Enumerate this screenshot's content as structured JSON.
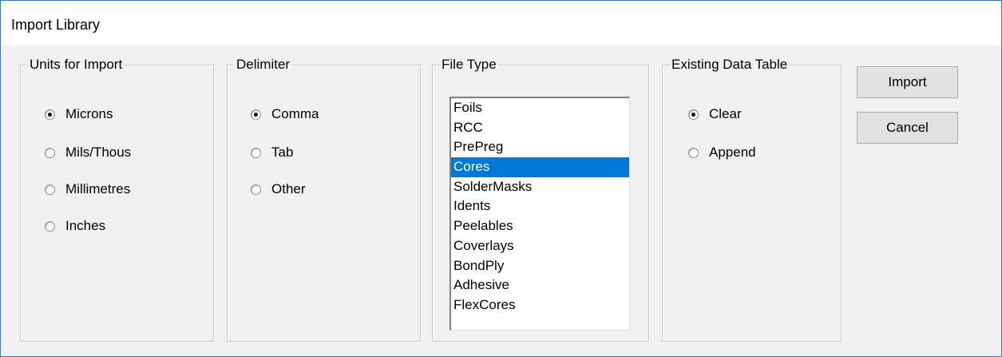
{
  "window": {
    "title": "Import Library"
  },
  "units_group": {
    "legend": "Units for Import",
    "options": [
      {
        "label": "Microns",
        "checked": true
      },
      {
        "label": "Mils/Thous",
        "checked": false
      },
      {
        "label": "Millimetres",
        "checked": false
      },
      {
        "label": "Inches",
        "checked": false
      }
    ]
  },
  "delimiter_group": {
    "legend": "Delimiter",
    "options": [
      {
        "label": "Comma",
        "checked": true
      },
      {
        "label": "Tab",
        "checked": false
      },
      {
        "label": "Other",
        "checked": false
      }
    ]
  },
  "file_type_group": {
    "legend": "File Type",
    "items": [
      "Foils",
      "RCC",
      "PrePreg",
      "Cores",
      "SolderMasks",
      "Idents",
      "Peelables",
      "Coverlays",
      "BondPly",
      "Adhesive",
      "FlexCores"
    ],
    "selected": "Cores"
  },
  "existing_group": {
    "legend": "Existing Data Table",
    "options": [
      {
        "label": "Clear",
        "checked": true
      },
      {
        "label": "Append",
        "checked": false
      }
    ]
  },
  "buttons": {
    "import_label": "Import",
    "cancel_label": "Cancel"
  },
  "colors": {
    "selection": "#0078d7",
    "window_border": "#3c78b4",
    "dialog_bg": "#f0f0f0"
  }
}
